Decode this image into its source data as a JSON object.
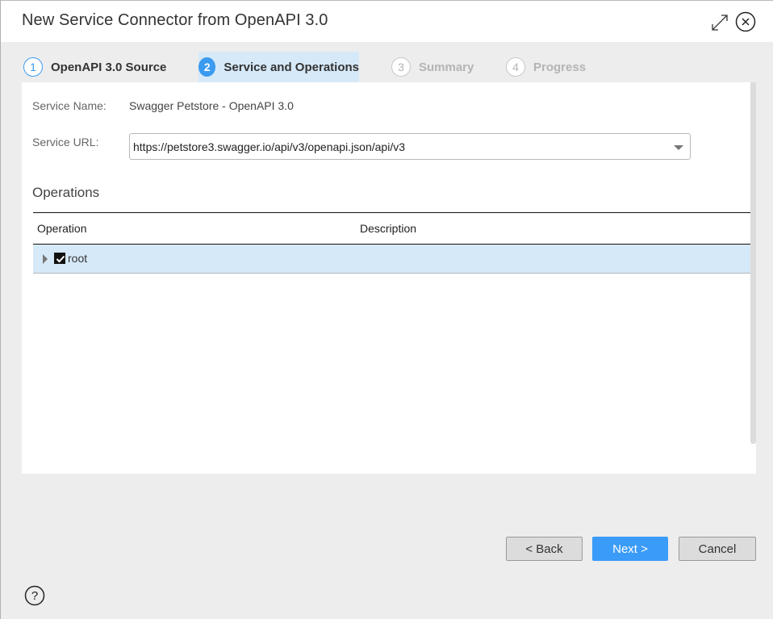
{
  "dialog": {
    "title": "New Service Connector from OpenAPI 3.0",
    "expand_icon": "expand-arrows-icon",
    "close_icon": "close-circle-icon"
  },
  "steps": [
    {
      "number": "1",
      "label": "OpenAPI 3.0 Source",
      "state": "done"
    },
    {
      "number": "2",
      "label": "Service and Operations",
      "state": "current"
    },
    {
      "number": "3",
      "label": "Summary",
      "state": "pending"
    },
    {
      "number": "4",
      "label": "Progress",
      "state": "pending"
    }
  ],
  "form": {
    "service_name_label": "Service Name:",
    "service_name_value": "Swagger Petstore - OpenAPI 3.0",
    "service_url_label": "Service URL:",
    "service_url_value": "https://petstore3.swagger.io/api/v3/openapi.json/api/v3"
  },
  "operations": {
    "section_title": "Operations",
    "columns": [
      "Operation",
      "Description"
    ],
    "rows": [
      {
        "name": "root",
        "description": "",
        "checked": true,
        "expanded": false
      }
    ]
  },
  "footer": {
    "back_label": "< Back",
    "next_label": "Next >",
    "cancel_label": "Cancel",
    "help_icon": "help-circle-icon"
  },
  "colors": {
    "accent": "#3a9bf8",
    "selection": "#d6e9f8",
    "background": "#ededed"
  }
}
